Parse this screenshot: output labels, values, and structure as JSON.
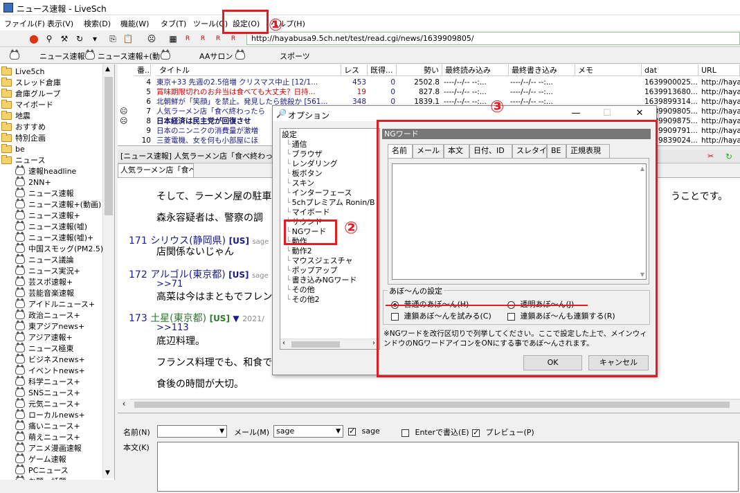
{
  "window": {
    "title": "ニュース速報 - LiveSch"
  },
  "menu": {
    "items": [
      "ファイル(F)",
      "表示(V)",
      "検索(D)",
      "機能(W)",
      "タブ(T)",
      "ツール(G)",
      "設定(O)",
      "ヘルプ(H)"
    ]
  },
  "url": "http://hayabusa9.5ch.net/test/read.cgi/news/1639909805/",
  "link_bar": {
    "items": [
      "ニュース速報",
      "ニュース速報+(動",
      "AAサロン",
      "スポーツ"
    ]
  },
  "sidebar": {
    "folders": [
      "Live5ch",
      "スレッド倉庫",
      "倉庫グループ",
      "マイボード",
      "地震",
      "おすすめ",
      "特別企画",
      "be",
      "ニュース"
    ],
    "boards": [
      "速報headline",
      "2NN+",
      "ニュース速報",
      "ニュース速報+(動画)",
      "ニュース速報+",
      "ニュース速報(嘘)",
      "ニュース速報(嘘)+",
      "中国スモッグ(PM2.5)",
      "ニュース議論",
      "ニュース実況+",
      "芸スポ速報+",
      "芸能音楽速報",
      "アイドルニュース+",
      "政治ニュース+",
      "東アジアnews+",
      "アジア速報+",
      "ニュース極東",
      "ビジネスnews+",
      "イベントnews+",
      "科学ニュース+",
      "SNSニュース+",
      "元気ニュース+",
      "ローカルnews+",
      "痛いニュース+",
      "萌えニュース+",
      "アニメ漫画速報",
      "ゲーム速報",
      "PCニュース",
      "お題・話題"
    ]
  },
  "thread_list": {
    "columns": [
      "番...",
      "タイトル",
      "レス",
      "既得...",
      "勢い",
      "最終読み込み",
      "最終書き込み",
      "メモ",
      "dat",
      "URL"
    ],
    "rows": [
      {
        "num": "4",
        "title": "東京+33 先週の2.5倍増 クリスマス中止 [12/1...",
        "res": "453",
        "read": "0",
        "ikioi": "2502.8",
        "lastread": "----/--/-- --:...",
        "lastwrite": "----/--/-- --:...",
        "dat": "1639900025...",
        "url": "http://haya",
        "color": "#1a1a8c"
      },
      {
        "num": "5",
        "title": "賞味期限切れのお弁当は食べても大丈夫？日持...",
        "res": "19",
        "read": "0",
        "ikioi": "827.8",
        "lastread": "----/--/-- --:...",
        "lastwrite": "----/--/-- --:...",
        "dat": "1639913680...",
        "url": "http://haya",
        "color": "#d40000"
      },
      {
        "num": "6",
        "title": "北朝鮮が「笑顔」を禁止。発見したら銃殺か [561...",
        "res": "348",
        "read": "0",
        "ikioi": "1839.1",
        "lastread": "----/--/-- --:...",
        "lastwrite": "----/--/-- --:...",
        "dat": "1639899314...",
        "url": "http://haya",
        "color": "#1a1a8c"
      },
      {
        "num": "7",
        "title": "人気ラーメン店「食べ終わったら",
        "res": "",
        "read": "",
        "ikioi": "",
        "lastread": "",
        "lastwrite": "",
        "dat": "1639909805...",
        "url": "http://haya",
        "color": "#1a1a8c"
      },
      {
        "num": "8",
        "title": "日本経済は民主党が回復させ",
        "res": "",
        "read": "",
        "ikioi": "",
        "lastread": "",
        "lastwrite": "",
        "dat": "1639909875...",
        "url": "http://haya",
        "color": "#0a0a6a"
      },
      {
        "num": "9",
        "title": "日本のニンニクの消費量が激増",
        "res": "",
        "read": "",
        "ikioi": "",
        "lastread": "",
        "lastwrite": "",
        "dat": "1639909791...",
        "url": "http://haya",
        "color": "#1a1a8c"
      },
      {
        "num": "10",
        "title": "三菱電機、女を何も小部屋にほ",
        "res": "",
        "read": "",
        "ikioi": "",
        "lastread": "",
        "lastwrite": "",
        "dat": "1639839024...",
        "url": "http://haya",
        "color": "#1a1a8c"
      }
    ]
  },
  "thread": {
    "header": "[ニュース速報] 人気ラーメン店「食べ終わっ",
    "tab_label": "人気ラーメン店「食べ",
    "lines": [
      {
        "text": "そして、ラーメン屋の駐車",
        "tail": "うことです。"
      },
      {
        "text": "森永容疑者は、警察の調"
      },
      {
        "num": "171",
        "name": "シリウス(静岡県)",
        "tag": "[US]",
        "mail": "sage",
        "body": "店関係ないじゃん"
      },
      {
        "num": "172",
        "name": "アルゴル(東京都)",
        "tag": "[US]",
        "mail": "sage",
        "anchor": ">>71",
        "body": "高菜は今はまともでフレン"
      },
      {
        "num": "173",
        "name": "土星(東京都)",
        "tag": "[US]",
        "date": "2021/",
        "anchor": ">>113",
        "body": "底辺料理。"
      },
      {
        "text": "フランス料理でも、和食で"
      },
      {
        "text": "食後の時間が大切。"
      }
    ]
  },
  "compose": {
    "name_label": "名前(N)",
    "mail_label": "メール(M)",
    "mail_value": "sage",
    "sage_label": "sage",
    "enter_label": "Enterで書込(E)",
    "preview_label": "プレビュー(P)",
    "body_label": "本文(K)"
  },
  "dialog": {
    "title": "オプション",
    "tree": [
      "設定",
      "通信",
      "ブラウザ",
      "レンダリング",
      "板ボタン",
      "スキン",
      "インターフェース",
      "5chプレミアム Ronin/B",
      "マイボード",
      "サウンド",
      "NGワード",
      "動作",
      "動作2",
      "マウスジェスチャ",
      "ポップアップ",
      "書き込みNGワード",
      "その他",
      "その他2"
    ],
    "panel_title": "NGワード",
    "tabs": [
      "名前",
      "メール",
      "本文",
      "日付、ID",
      "スレタイ",
      "BE",
      "正規表現"
    ],
    "group_label": "あぼ～んの設定",
    "radio1": "普通のあぼ～ん(H)",
    "radio2": "透明あぼ～ん(J)",
    "check1": "連鎖あぼ～んを試みる(C)",
    "check2": "連鎖あぼ～んも連鎖する(R)",
    "note": "※NGワードを改行区切りで列挙してください。ここで設定した上で、メインウィンドウのNGワードアイコンをONにする事であぼ～んされます。",
    "ok": "OK",
    "cancel": "キャンセル"
  },
  "annotations": {
    "one": "①",
    "two": "②",
    "three": "③"
  },
  "colors": {
    "accent_red": "#e51b24",
    "link_blue": "#1a1a8c",
    "name_green": "#2a7a2a"
  }
}
